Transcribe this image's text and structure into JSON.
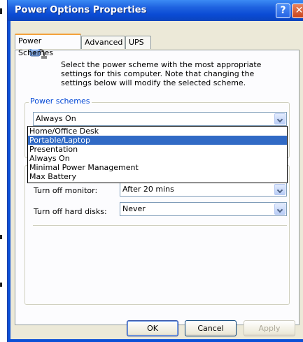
{
  "window": {
    "title": "Power Options Properties",
    "help_button": "?",
    "close_button": "✕"
  },
  "tabs": [
    {
      "label": "Power Schemes",
      "active": true
    },
    {
      "label": "Advanced",
      "active": false
    },
    {
      "label": "UPS",
      "active": false
    }
  ],
  "description": "Select the power scheme with the most appropriate settings for this computer. Note that changing the settings below will modify the selected scheme.",
  "power_schemes": {
    "group_label": "Power schemes",
    "selected_value": "Always On",
    "options": [
      "Home/Office Desk",
      "Portable/Laptop",
      "Presentation",
      "Always On",
      "Minimal Power Management",
      "Max Battery"
    ],
    "highlighted_option": "Portable/Laptop"
  },
  "settings": {
    "monitor_label": "Turn off monitor:",
    "monitor_value": "After 20 mins",
    "hard_disks_label": "Turn off hard disks:",
    "hard_disks_value": "Never"
  },
  "buttons": {
    "ok": "OK",
    "cancel": "Cancel",
    "apply": "Apply"
  },
  "colors": {
    "title_bar": "#0a4bd4",
    "dialog_face": "#ece9d8",
    "selection": "#316ac5",
    "group_label": "#0046d5"
  }
}
